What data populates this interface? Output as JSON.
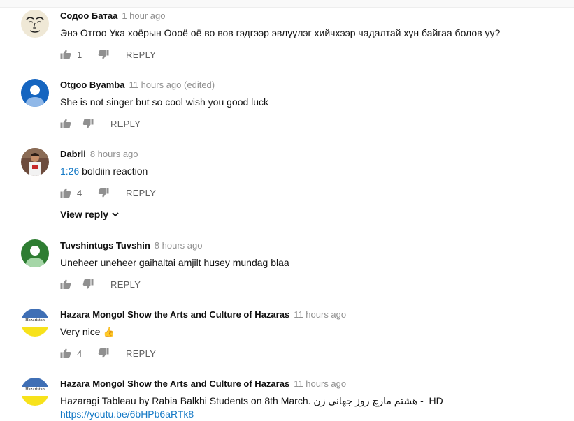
{
  "comments": [
    {
      "author": "Содоо Батаа",
      "time": "1 hour ago",
      "edited": "",
      "text": "Энэ Отгоо Ука хоёрын Оооё оё во вов гэдгээр эвлүүлэг хийчхээр чадалтай хүн байгаа болов уу?",
      "likes": "1",
      "reply_label": "REPLY",
      "avatar_icon": "drawn-face-avatar"
    },
    {
      "author": "Otgoo Byamba",
      "time": "11 hours ago",
      "edited": "(edited)",
      "text": "She is not singer  but  so cool wish you good luck",
      "likes": "",
      "reply_label": "REPLY",
      "avatar_icon": "default-user-avatar",
      "avatar_color": "#1565c0"
    },
    {
      "author": "Dabrii",
      "time": "8 hours ago",
      "edited": "",
      "timestamp_link": "1:26",
      "text": " boldiin reaction",
      "likes": "4",
      "reply_label": "REPLY",
      "avatar_icon": "photo-avatar",
      "view_reply_label": "View reply"
    },
    {
      "author": "Tuvshintugs Tuvshin",
      "time": "8 hours ago",
      "edited": "",
      "text": "Uneheer uneheer gaihaltai amjilt husey mundag blaa",
      "likes": "",
      "reply_label": "REPLY",
      "avatar_icon": "default-user-avatar",
      "avatar_color": "#2e7d32"
    },
    {
      "author": "Hazara Mongol Show the Arts and Culture of Hazaras",
      "time": "11 hours ago",
      "edited": "",
      "text": "Very nice ",
      "emoji": "👍",
      "likes": "4",
      "reply_label": "REPLY",
      "avatar_icon": "hazaristan-logo-avatar",
      "avatar_logo_text": "Hazaristan"
    },
    {
      "author": "Hazara Mongol Show the Arts and Culture of Hazaras",
      "time": "11 hours ago",
      "edited": "",
      "text": "Hazaragi Tableau by Rabia Balkhi Students on 8th March. هشتم مارچ روز جهانی زن -_HD",
      "link": "https://youtu.be/6bHPb6aRTk8",
      "avatar_icon": "hazaristan-logo-avatar",
      "avatar_logo_text": "Hazaristan"
    }
  ],
  "colors": {
    "link": "#167ac6",
    "meta_text": "#909090",
    "action_text": "#606060",
    "icon": "#909090"
  }
}
